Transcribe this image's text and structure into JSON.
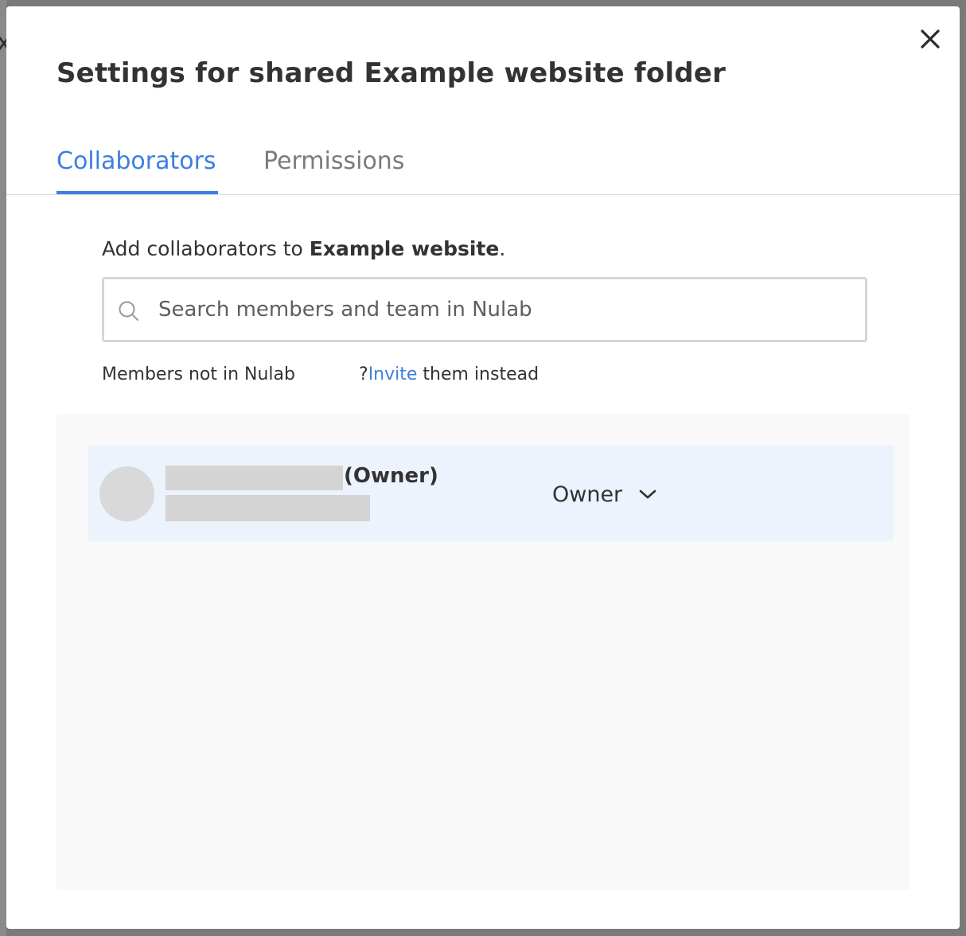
{
  "backdrop": {
    "glyph": "x"
  },
  "dialog": {
    "title": "Settings for shared Example website folder",
    "close_icon": "close-icon"
  },
  "tabs": [
    {
      "label": "Collaborators",
      "active": true
    },
    {
      "label": "Permissions",
      "active": false
    }
  ],
  "collaborators": {
    "add_prefix": "Add collaborators to ",
    "folder_name": "Example website",
    "add_suffix": ".",
    "search": {
      "placeholder": "Search members and team in Nulab",
      "value": "",
      "icon": "search-icon"
    },
    "not_in_text": "Members not in Nulab",
    "invite_prefix": "?",
    "invite_link": "Invite",
    "invite_suffix": " them instead",
    "members": [
      {
        "owner_tag": "(Owner)",
        "role": "Owner",
        "role_icon": "chevron-down-icon"
      }
    ]
  },
  "colors": {
    "accent": "#3d7ee3",
    "row_highlight": "#ecf3fd",
    "panel_bg": "#f9f9f9"
  }
}
